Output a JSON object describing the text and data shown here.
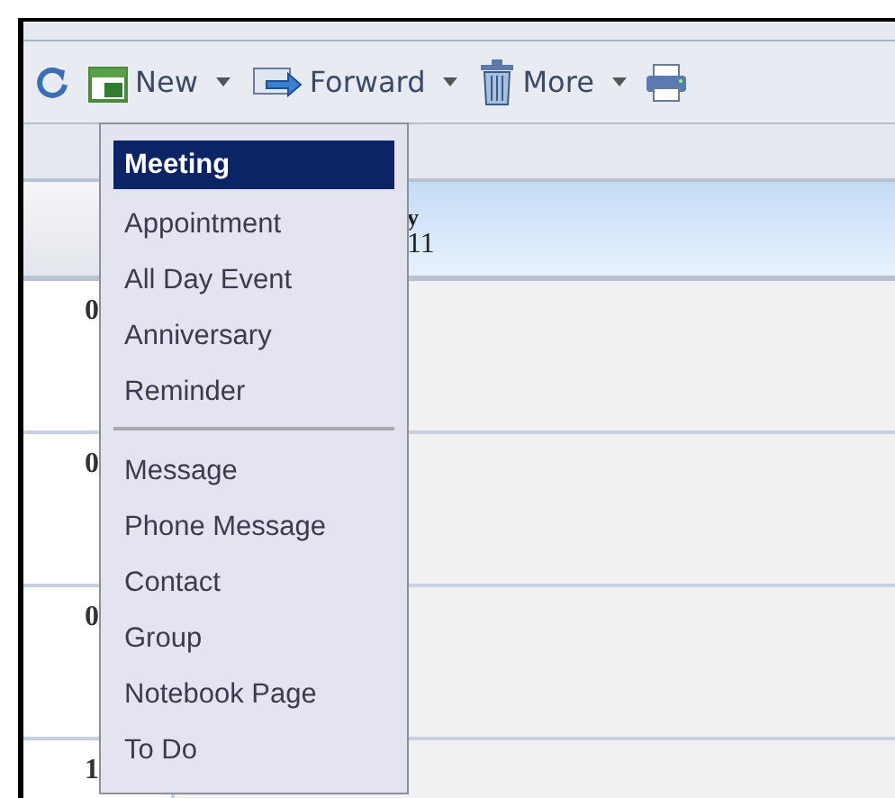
{
  "toolbar": {
    "items": [
      {
        "kind": "refresh"
      },
      {
        "kind": "new",
        "label": "New",
        "has_menu": true
      },
      {
        "kind": "forward",
        "label": "Forward",
        "has_menu": true
      },
      {
        "kind": "delete",
        "label": "More",
        "has_menu": true
      },
      {
        "kind": "print"
      }
    ]
  },
  "day_header": {
    "day": "y",
    "date": "11"
  },
  "time_rows": [
    {
      "label": "0"
    },
    {
      "label": "0"
    },
    {
      "label": "0"
    },
    {
      "label": "1"
    }
  ],
  "new_menu": {
    "items": [
      {
        "kind": "item",
        "label": "Meeting",
        "selected": true
      },
      {
        "kind": "item",
        "label": "Appointment",
        "selected": false
      },
      {
        "kind": "item",
        "label": "All Day Event",
        "selected": false
      },
      {
        "kind": "item",
        "label": "Anniversary",
        "selected": false
      },
      {
        "kind": "item",
        "label": "Reminder",
        "selected": false
      },
      {
        "kind": "separator"
      },
      {
        "kind": "item",
        "label": "Message",
        "selected": false
      },
      {
        "kind": "item",
        "label": "Phone Message",
        "selected": false
      },
      {
        "kind": "item",
        "label": "Contact",
        "selected": false
      },
      {
        "kind": "item",
        "label": "Group",
        "selected": false
      },
      {
        "kind": "item",
        "label": "Notebook Page",
        "selected": false
      },
      {
        "kind": "item",
        "label": "To Do",
        "selected": false
      }
    ]
  }
}
